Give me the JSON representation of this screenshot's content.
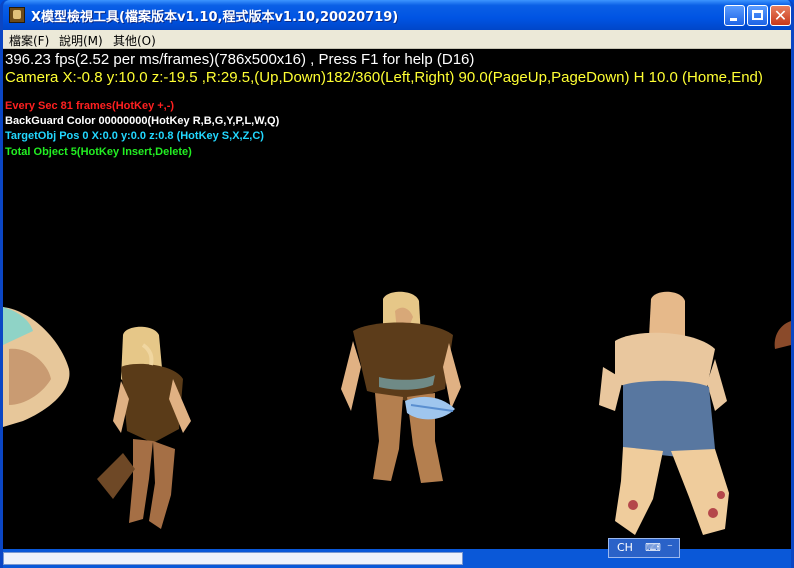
{
  "window": {
    "title": "X模型檢視工具(檔案版本v1.10,程式版本v1.10,20020719)"
  },
  "menu": [
    {
      "label": "檔案(F)"
    },
    {
      "label": "說明(M)"
    },
    {
      "label": "其他(O)"
    }
  ],
  "overlay": {
    "fps": "396.23 fps(2.52 per ms/frames)(786x500x16) , Press F1 for help (D16)",
    "camera": "Camera X:-0.8 y:10.0 z:-19.5 ,R:29.5,(Up,Down)182/360(Left,Right) 90.0(PageUp,PageDown) H 10.0 (Home,End)",
    "every_sec": "Every Sec 81 frames(HotKey +,-)",
    "backguard": "BackGuard Color 00000000(HotKey R,B,G,Y,P,L,W,Q)",
    "target": "TargetObj Pos 0 X:0.0 y:0.0 z:0.8 (HotKey S,X,Z,C)",
    "total": "Total Object 5(HotKey Insert,Delete)"
  },
  "ime": {
    "label": "CH"
  }
}
